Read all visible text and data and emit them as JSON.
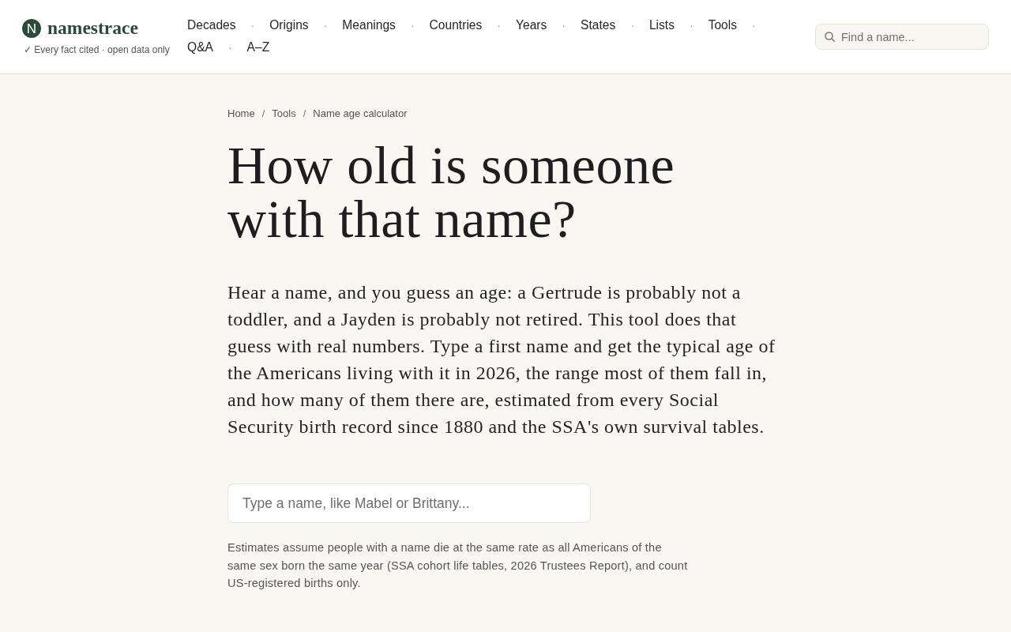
{
  "header": {
    "logo": {
      "mark": "N",
      "name": "namestrace",
      "tagline": "✓ Every fact cited · open data only"
    },
    "nav": {
      "separator": "·",
      "items": [
        "Decades",
        "Origins",
        "Meanings",
        "Countries",
        "Years",
        "States",
        "Lists",
        "Tools",
        "Q&A",
        "A–Z"
      ]
    },
    "search": {
      "placeholder": "Find a name..."
    }
  },
  "breadcrumb": {
    "separator": "/",
    "items": [
      "Home",
      "Tools",
      "Name age calculator"
    ]
  },
  "title": "How old is someone with that name?",
  "intro": "Hear a name, and you guess an age: a Gertrude is probably not a toddler, and a Jayden is probably not retired. This tool does that guess with real numbers. Type a first name and get the typical age of the Americans living with it in 2026, the range most of them fall in, and how many of them there are, estimated from every Social Security birth record since 1880 and the SSA's own survival tables.",
  "name_input": {
    "placeholder": "Type a name, like Mabel or Brittany..."
  },
  "note": "Estimates assume people with a name die at the same rate as all Americans of the same sex born the same year (SSA cohort life tables, 2026 Trustees Report), and count US-registered births only."
}
